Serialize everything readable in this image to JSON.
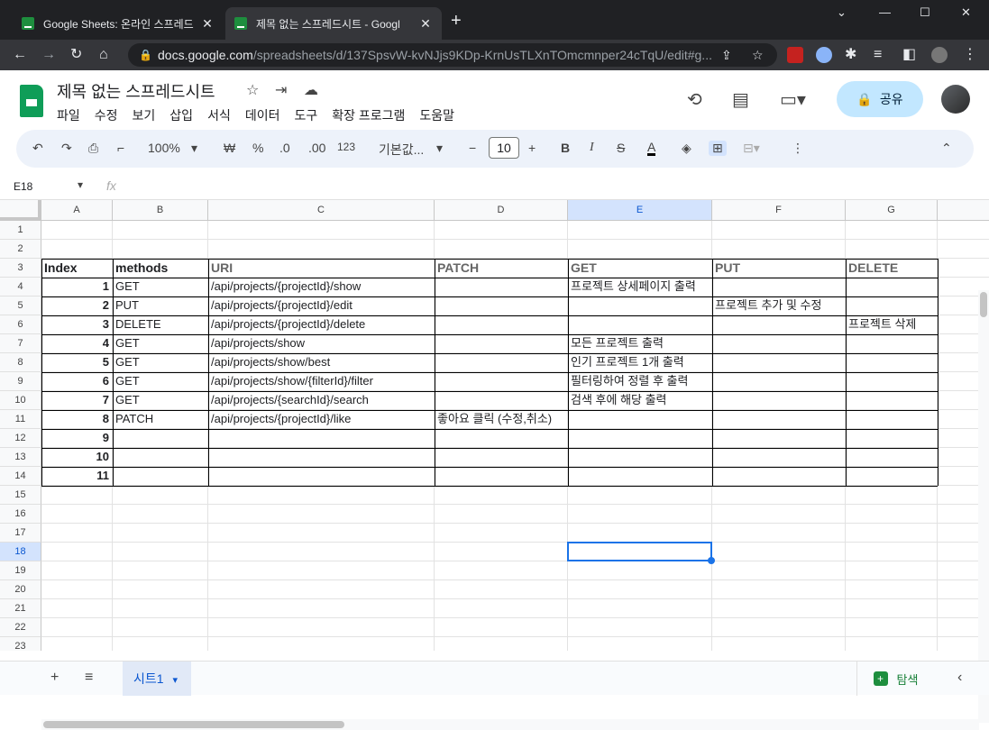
{
  "browser": {
    "tabs": [
      {
        "title": "Google Sheets: 온라인 스프레드"
      },
      {
        "title": "제목 없는 스프레드시트 - Googl"
      }
    ],
    "new_tab": "+",
    "address": {
      "host": "docs.google.com",
      "path": "/spreadsheets/d/137SpsvW-kvNJjs9KDp-KrnUsTLXnTOmcmnper24cTqU/edit#g..."
    }
  },
  "document": {
    "title": "제목 없는 스프레드시트",
    "menu": [
      "파일",
      "수정",
      "보기",
      "삽입",
      "서식",
      "데이터",
      "도구",
      "확장 프로그램",
      "도움말"
    ],
    "share_label": "공유"
  },
  "toolbar": {
    "zoom": "100%",
    "currency": "₩",
    "percent": "%",
    "dec_decrease": ".0",
    "dec_increase": ".00",
    "number_format": "123",
    "font": "기본값...",
    "font_size": "10",
    "bold": "B",
    "italic": "I",
    "strike": "S",
    "text_color": "A"
  },
  "formula_bar": {
    "cell_ref": "E18",
    "fx": "fx",
    "value": ""
  },
  "grid": {
    "columns": [
      "A",
      "B",
      "C",
      "D",
      "E",
      "F",
      "G"
    ],
    "rows": [
      "1",
      "2",
      "3",
      "4",
      "5",
      "6",
      "7",
      "8",
      "9",
      "10",
      "11",
      "12",
      "13",
      "14",
      "15",
      "16",
      "17",
      "18",
      "19",
      "20",
      "21",
      "22",
      "23"
    ],
    "selected_cell": "E18",
    "header": [
      "Index",
      "methods",
      "URI",
      "PATCH",
      "GET",
      "PUT",
      "DELETE"
    ],
    "data": [
      [
        "1",
        "GET",
        "/api/projects/{projectId}/show",
        "",
        "프로젝트 상세페이지 출력",
        "",
        ""
      ],
      [
        "2",
        "PUT",
        "/api/projects/{projectId}/edit",
        "",
        "",
        "프로젝트 추가 및 수정",
        ""
      ],
      [
        "3",
        "DELETE",
        "/api/projects/{projectId}/delete",
        "",
        "",
        "",
        "프로젝트 삭제"
      ],
      [
        "4",
        "GET",
        "/api/projects/show",
        "",
        "모든 프로젝트 출력",
        "",
        ""
      ],
      [
        "5",
        "GET",
        "/api/projects/show/best",
        "",
        "인기 프로젝트 1개 출력",
        "",
        ""
      ],
      [
        "6",
        "GET",
        "/api/projects/show/{filterId}/filter",
        "",
        "필터링하여 정렬 후 출력",
        "",
        ""
      ],
      [
        "7",
        "GET",
        "/api/projects/{searchId}/search",
        "",
        "검색 후에 해당 출력",
        "",
        ""
      ],
      [
        "8",
        "PATCH",
        "/api/projects/{projectId}/like",
        "좋아요 클릭 (수정,취소)",
        "",
        "",
        ""
      ],
      [
        "9",
        "",
        "",
        "",
        "",
        "",
        ""
      ],
      [
        "10",
        "",
        "",
        "",
        "",
        "",
        ""
      ],
      [
        "11",
        "",
        "",
        "",
        "",
        "",
        ""
      ]
    ]
  },
  "bottom": {
    "add": "+",
    "sheet_list": "≡",
    "sheet_name": "시트1",
    "explore": "탐색"
  }
}
